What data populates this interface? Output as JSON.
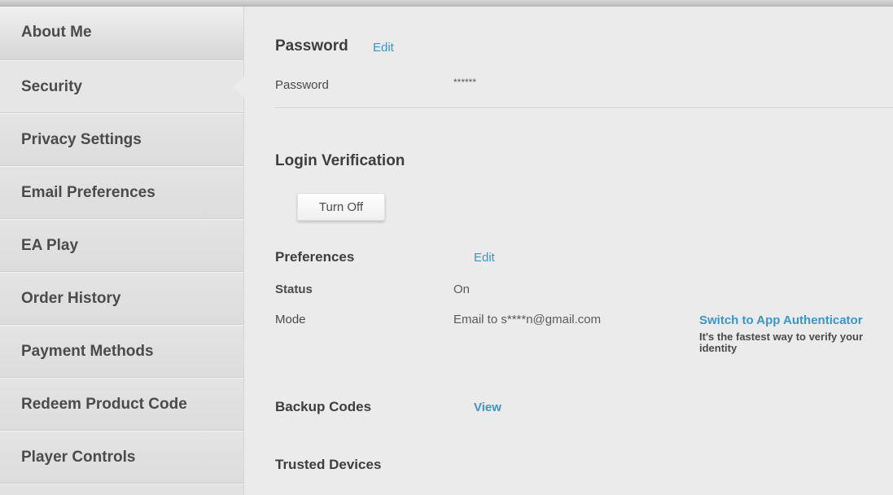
{
  "sidebar": {
    "active_index": 1,
    "items": [
      {
        "label": "About Me"
      },
      {
        "label": "Security"
      },
      {
        "label": "Privacy Settings"
      },
      {
        "label": "Email Preferences"
      },
      {
        "label": "EA Play"
      },
      {
        "label": "Order History"
      },
      {
        "label": "Payment Methods"
      },
      {
        "label": "Redeem Product Code"
      },
      {
        "label": "Player Controls"
      }
    ]
  },
  "password": {
    "title": "Password",
    "edit_label": "Edit",
    "field_label": "Password",
    "field_value": "******"
  },
  "login_verification": {
    "title": "Login Verification",
    "turn_off_label": "Turn Off",
    "preferences": {
      "title": "Preferences",
      "edit_label": "Edit",
      "status_label": "Status",
      "status_value": "On",
      "mode_label": "Mode",
      "mode_value": "Email to s****n@gmail.com",
      "switch_link": "Switch to App Authenticator",
      "switch_hint": "It's the fastest way to verify your identity"
    },
    "backup_codes": {
      "title": "Backup Codes",
      "view_label": "View"
    },
    "trusted_devices": {
      "title": "Trusted Devices"
    }
  },
  "colors": {
    "link": "#3d94c6",
    "background": "#ebebeb",
    "sidebar": "#e2e2e2"
  }
}
